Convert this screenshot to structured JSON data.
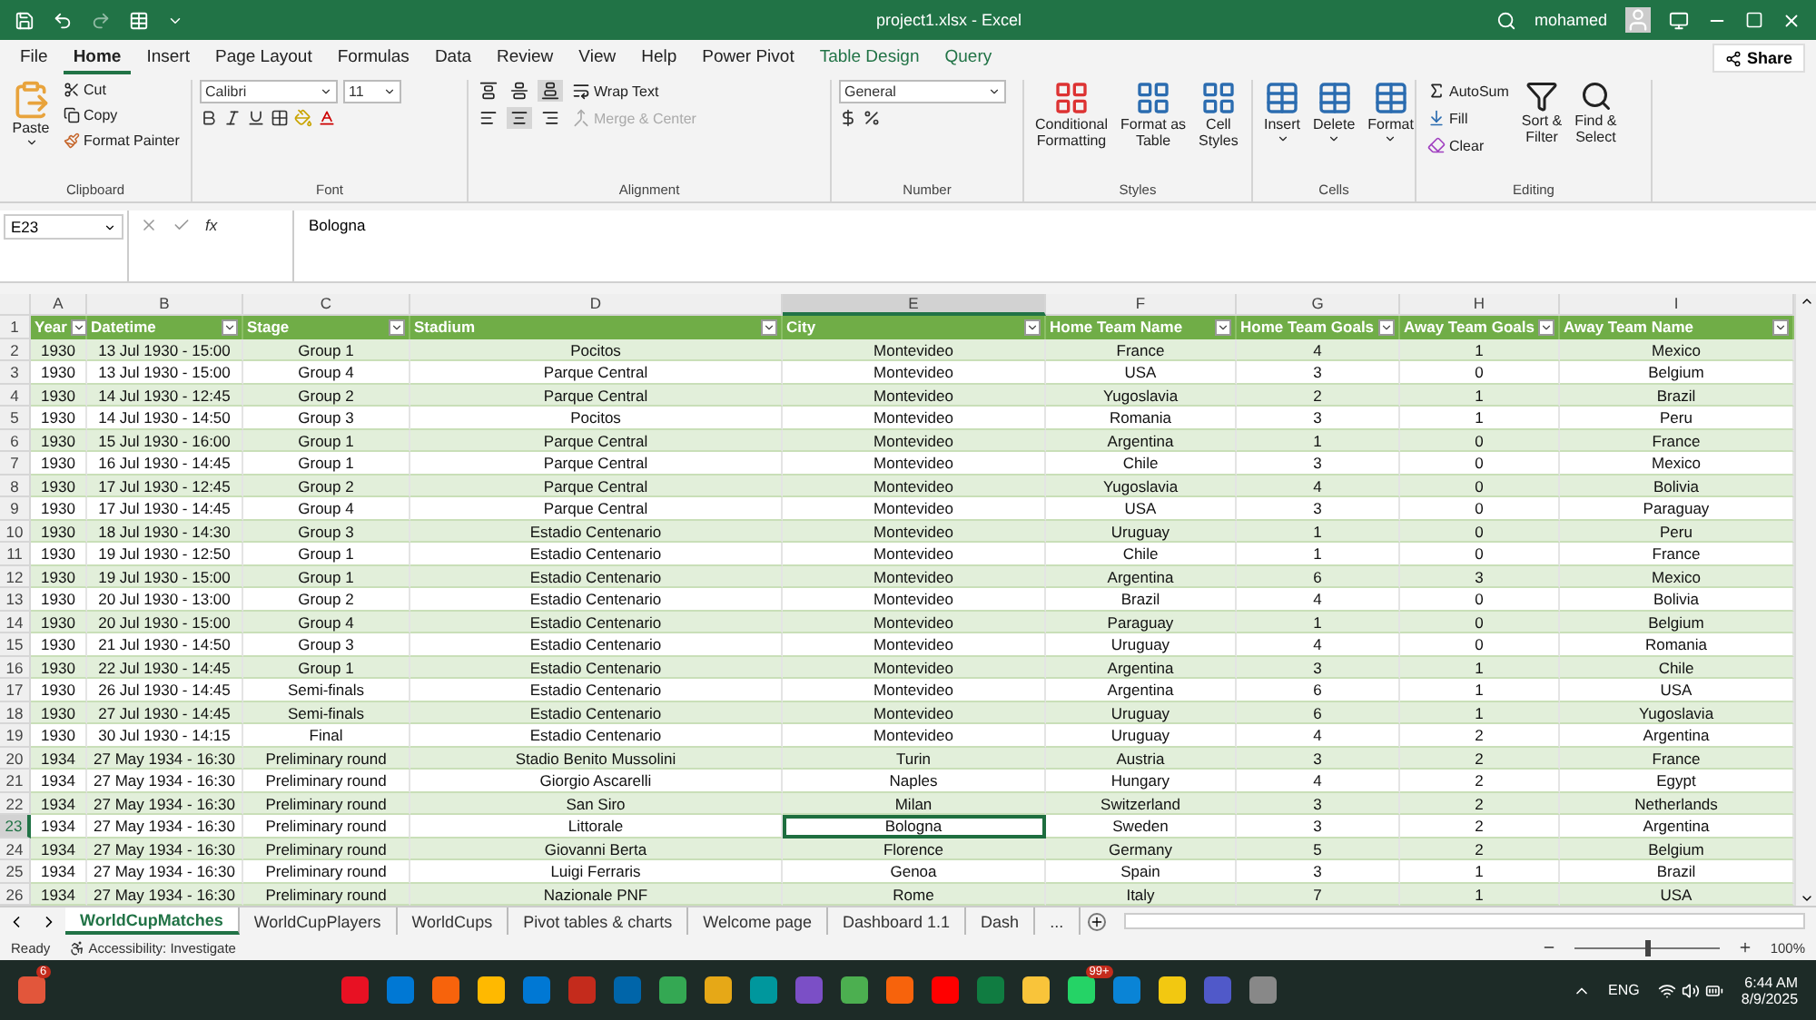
{
  "title_bar": {
    "title": "project1.xlsx - Excel",
    "user": "mohamed"
  },
  "ribbon_tabs": [
    {
      "label": "File",
      "selected": false,
      "kind": "standard"
    },
    {
      "label": "Home",
      "selected": true,
      "kind": "standard"
    },
    {
      "label": "Insert",
      "selected": false,
      "kind": "standard"
    },
    {
      "label": "Page Layout",
      "selected": false,
      "kind": "standard"
    },
    {
      "label": "Formulas",
      "selected": false,
      "kind": "standard"
    },
    {
      "label": "Data",
      "selected": false,
      "kind": "standard"
    },
    {
      "label": "Review",
      "selected": false,
      "kind": "standard"
    },
    {
      "label": "View",
      "selected": false,
      "kind": "standard"
    },
    {
      "label": "Help",
      "selected": false,
      "kind": "standard"
    },
    {
      "label": "Power Pivot",
      "selected": false,
      "kind": "standard"
    },
    {
      "label": "Table Design",
      "selected": false,
      "kind": "contextual"
    },
    {
      "label": "Query",
      "selected": false,
      "kind": "contextual"
    }
  ],
  "share": "Share",
  "ribbon": {
    "clipboard": {
      "name": "Clipboard",
      "paste": "Paste",
      "cut": "Cut",
      "copy": "Copy",
      "format_painter": "Format Painter"
    },
    "font": {
      "name": "Font",
      "font_name": "Calibri",
      "font_size": "11"
    },
    "alignment": {
      "name": "Alignment",
      "vertical": [
        {
          "selected": false
        },
        {
          "selected": false
        },
        {
          "selected": true
        }
      ],
      "horizontal": [
        {
          "selected": false
        },
        {
          "selected": true
        },
        {
          "selected": false
        }
      ],
      "wrap_text": "Wrap Text",
      "merge": {
        "label": "Merge & Center",
        "disabled": true
      }
    },
    "number": {
      "name": "Number",
      "format": "General"
    },
    "styles": {
      "name": "Styles",
      "buttons": [
        [
          "Conditional",
          "Formatting"
        ],
        [
          "Format as",
          "Table"
        ],
        [
          "Cell",
          "Styles"
        ]
      ]
    },
    "cells": {
      "name": "Cells",
      "buttons": [
        "Insert",
        "Delete",
        "Format"
      ]
    },
    "editing": {
      "name": "Editing",
      "autosum": "AutoSum",
      "fill": "Fill",
      "clear": "Clear",
      "sort": [
        "Sort &",
        "Filter"
      ],
      "find": [
        "Find &",
        "Select"
      ]
    }
  },
  "formula_bar": {
    "name_box": "E23",
    "fx": "fx",
    "value": "Bologna"
  },
  "columns": [
    {
      "letter": "A",
      "selected": false
    },
    {
      "letter": "B",
      "selected": false
    },
    {
      "letter": "C",
      "selected": false
    },
    {
      "letter": "D",
      "selected": false
    },
    {
      "letter": "E",
      "selected": true
    },
    {
      "letter": "F",
      "selected": false
    },
    {
      "letter": "G",
      "selected": false
    },
    {
      "letter": "H",
      "selected": false
    },
    {
      "letter": "I",
      "selected": false
    }
  ],
  "table": {
    "header_row": "1",
    "headers": [
      "Year",
      "Datetime",
      "Stage",
      "Stadium",
      "City",
      "Home Team Name",
      "Home Team Goals",
      "Away Team Goals",
      "Away Team Name"
    ],
    "rows": [
      {
        "num": "2",
        "selected": false,
        "cells": [
          "1930",
          "13 Jul 1930 - 15:00",
          "Group 1",
          "Pocitos",
          "Montevideo",
          "France",
          "4",
          "1",
          "Mexico"
        ]
      },
      {
        "num": "3",
        "selected": false,
        "cells": [
          "1930",
          "13 Jul 1930 - 15:00",
          "Group 4",
          "Parque Central",
          "Montevideo",
          "USA",
          "3",
          "0",
          "Belgium"
        ]
      },
      {
        "num": "4",
        "selected": false,
        "cells": [
          "1930",
          "14 Jul 1930 - 12:45",
          "Group 2",
          "Parque Central",
          "Montevideo",
          "Yugoslavia",
          "2",
          "1",
          "Brazil"
        ]
      },
      {
        "num": "5",
        "selected": false,
        "cells": [
          "1930",
          "14 Jul 1930 - 14:50",
          "Group 3",
          "Pocitos",
          "Montevideo",
          "Romania",
          "3",
          "1",
          "Peru"
        ]
      },
      {
        "num": "6",
        "selected": false,
        "cells": [
          "1930",
          "15 Jul 1930 - 16:00",
          "Group 1",
          "Parque Central",
          "Montevideo",
          "Argentina",
          "1",
          "0",
          "France"
        ]
      },
      {
        "num": "7",
        "selected": false,
        "cells": [
          "1930",
          "16 Jul 1930 - 14:45",
          "Group 1",
          "Parque Central",
          "Montevideo",
          "Chile",
          "3",
          "0",
          "Mexico"
        ]
      },
      {
        "num": "8",
        "selected": false,
        "cells": [
          "1930",
          "17 Jul 1930 - 12:45",
          "Group 2",
          "Parque Central",
          "Montevideo",
          "Yugoslavia",
          "4",
          "0",
          "Bolivia"
        ]
      },
      {
        "num": "9",
        "selected": false,
        "cells": [
          "1930",
          "17 Jul 1930 - 14:45",
          "Group 4",
          "Parque Central",
          "Montevideo",
          "USA",
          "3",
          "0",
          "Paraguay"
        ]
      },
      {
        "num": "10",
        "selected": false,
        "cells": [
          "1930",
          "18 Jul 1930 - 14:30",
          "Group 3",
          "Estadio Centenario",
          "Montevideo",
          "Uruguay",
          "1",
          "0",
          "Peru"
        ]
      },
      {
        "num": "11",
        "selected": false,
        "cells": [
          "1930",
          "19 Jul 1930 - 12:50",
          "Group 1",
          "Estadio Centenario",
          "Montevideo",
          "Chile",
          "1",
          "0",
          "France"
        ]
      },
      {
        "num": "12",
        "selected": false,
        "cells": [
          "1930",
          "19 Jul 1930 - 15:00",
          "Group 1",
          "Estadio Centenario",
          "Montevideo",
          "Argentina",
          "6",
          "3",
          "Mexico"
        ]
      },
      {
        "num": "13",
        "selected": false,
        "cells": [
          "1930",
          "20 Jul 1930 - 13:00",
          "Group 2",
          "Estadio Centenario",
          "Montevideo",
          "Brazil",
          "4",
          "0",
          "Bolivia"
        ]
      },
      {
        "num": "14",
        "selected": false,
        "cells": [
          "1930",
          "20 Jul 1930 - 15:00",
          "Group 4",
          "Estadio Centenario",
          "Montevideo",
          "Paraguay",
          "1",
          "0",
          "Belgium"
        ]
      },
      {
        "num": "15",
        "selected": false,
        "cells": [
          "1930",
          "21 Jul 1930 - 14:50",
          "Group 3",
          "Estadio Centenario",
          "Montevideo",
          "Uruguay",
          "4",
          "0",
          "Romania"
        ]
      },
      {
        "num": "16",
        "selected": false,
        "cells": [
          "1930",
          "22 Jul 1930 - 14:45",
          "Group 1",
          "Estadio Centenario",
          "Montevideo",
          "Argentina",
          "3",
          "1",
          "Chile"
        ]
      },
      {
        "num": "17",
        "selected": false,
        "cells": [
          "1930",
          "26 Jul 1930 - 14:45",
          "Semi-finals",
          "Estadio Centenario",
          "Montevideo",
          "Argentina",
          "6",
          "1",
          "USA"
        ]
      },
      {
        "num": "18",
        "selected": false,
        "cells": [
          "1930",
          "27 Jul 1930 - 14:45",
          "Semi-finals",
          "Estadio Centenario",
          "Montevideo",
          "Uruguay",
          "6",
          "1",
          "Yugoslavia"
        ]
      },
      {
        "num": "19",
        "selected": false,
        "cells": [
          "1930",
          "30 Jul 1930 - 14:15",
          "Final",
          "Estadio Centenario",
          "Montevideo",
          "Uruguay",
          "4",
          "2",
          "Argentina"
        ]
      },
      {
        "num": "20",
        "selected": false,
        "cells": [
          "1934",
          "27 May 1934 - 16:30",
          "Preliminary round",
          "Stadio Benito Mussolini",
          "Turin",
          "Austria",
          "3",
          "2",
          "France"
        ]
      },
      {
        "num": "21",
        "selected": false,
        "cells": [
          "1934",
          "27 May 1934 - 16:30",
          "Preliminary round",
          "Giorgio Ascarelli",
          "Naples",
          "Hungary",
          "4",
          "2",
          "Egypt"
        ]
      },
      {
        "num": "22",
        "selected": false,
        "cells": [
          "1934",
          "27 May 1934 - 16:30",
          "Preliminary round",
          "San Siro",
          "Milan",
          "Switzerland",
          "3",
          "2",
          "Netherlands"
        ]
      },
      {
        "num": "23",
        "selected": true,
        "cells": [
          "1934",
          "27 May 1934 - 16:30",
          "Preliminary round",
          "Littorale",
          "Bologna",
          "Sweden",
          "3",
          "2",
          "Argentina"
        ]
      },
      {
        "num": "24",
        "selected": false,
        "cells": [
          "1934",
          "27 May 1934 - 16:30",
          "Preliminary round",
          "Giovanni Berta",
          "Florence",
          "Germany",
          "5",
          "2",
          "Belgium"
        ]
      },
      {
        "num": "25",
        "selected": false,
        "cells": [
          "1934",
          "27 May 1934 - 16:30",
          "Preliminary round",
          "Luigi Ferraris",
          "Genoa",
          "Spain",
          "3",
          "1",
          "Brazil"
        ]
      },
      {
        "num": "26",
        "selected": false,
        "cells": [
          "1934",
          "27 May 1934 - 16:30",
          "Preliminary round",
          "Nazionale PNF",
          "Rome",
          "Italy",
          "7",
          "1",
          "USA"
        ]
      }
    ]
  },
  "sheet_tabs": [
    {
      "label": "WorldCupMatches",
      "selected": true
    },
    {
      "label": "WorldCupPlayers",
      "selected": false
    },
    {
      "label": "WorldCups",
      "selected": false
    },
    {
      "label": "Pivot tables & charts",
      "selected": false
    },
    {
      "label": "Welcome page",
      "selected": false
    },
    {
      "label": "Dashboard 1.1",
      "selected": false
    },
    {
      "label": "Dash",
      "selected": false
    }
  ],
  "more_sheets": "...",
  "status_bar": {
    "ready": "Ready",
    "accessibility": "Accessibility: Investigate",
    "zoom": "100%",
    "zoom_slider": {
      "level": 0.5
    }
  },
  "taskbar": {
    "notification_badge": "6",
    "chat_badge": "99+",
    "language": "ENG",
    "time": "6:44 AM",
    "date": "8/9/2025"
  }
}
